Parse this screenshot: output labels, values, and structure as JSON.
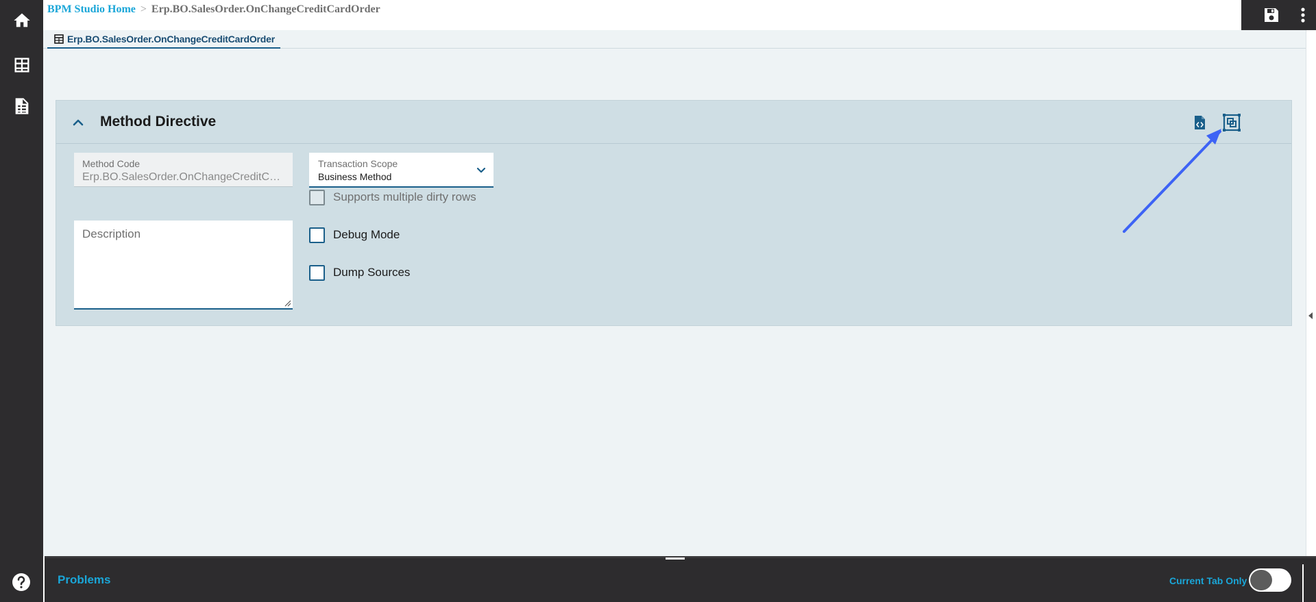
{
  "breadcrumb": {
    "home": "BPM Studio Home",
    "separator": ">",
    "current": "Erp.BO.SalesOrder.OnChangeCreditCardOrder"
  },
  "tab": {
    "label": "Erp.BO.SalesOrder.OnChangeCreditCardOrder"
  },
  "panel": {
    "title": "Method Directive",
    "method_code": {
      "label": "Method Code",
      "value": "Erp.BO.SalesOrder.OnChangeCreditCardOrder"
    },
    "transaction_scope": {
      "label": "Transaction Scope",
      "value": "Business Method"
    },
    "description": {
      "placeholder": "Description"
    },
    "checkboxes": [
      {
        "label": "Supports multiple dirty rows",
        "checked": false,
        "disabled": true
      },
      {
        "label": "Debug Mode",
        "checked": false,
        "disabled": false
      },
      {
        "label": "Dump Sources",
        "checked": false,
        "disabled": false
      }
    ]
  },
  "bottom": {
    "problems_label": "Problems",
    "current_tab_label": "Current Tab Only",
    "current_tab_only_on": false
  },
  "icons": {
    "rail": [
      "home-icon",
      "grid-icon",
      "document-list-icon",
      "help-icon"
    ],
    "header": [
      "save-icon",
      "more-vertical-icon"
    ],
    "panel": [
      "collapse-chevron-icon",
      "code-file-icon",
      "expand-panel-icon"
    ]
  },
  "colors": {
    "accent": "#1aa6d8",
    "primary": "#1a5f8a",
    "rail": "#2d2c2e",
    "panel": "#cfdee4",
    "annotation_arrow": "#3d63f5"
  }
}
